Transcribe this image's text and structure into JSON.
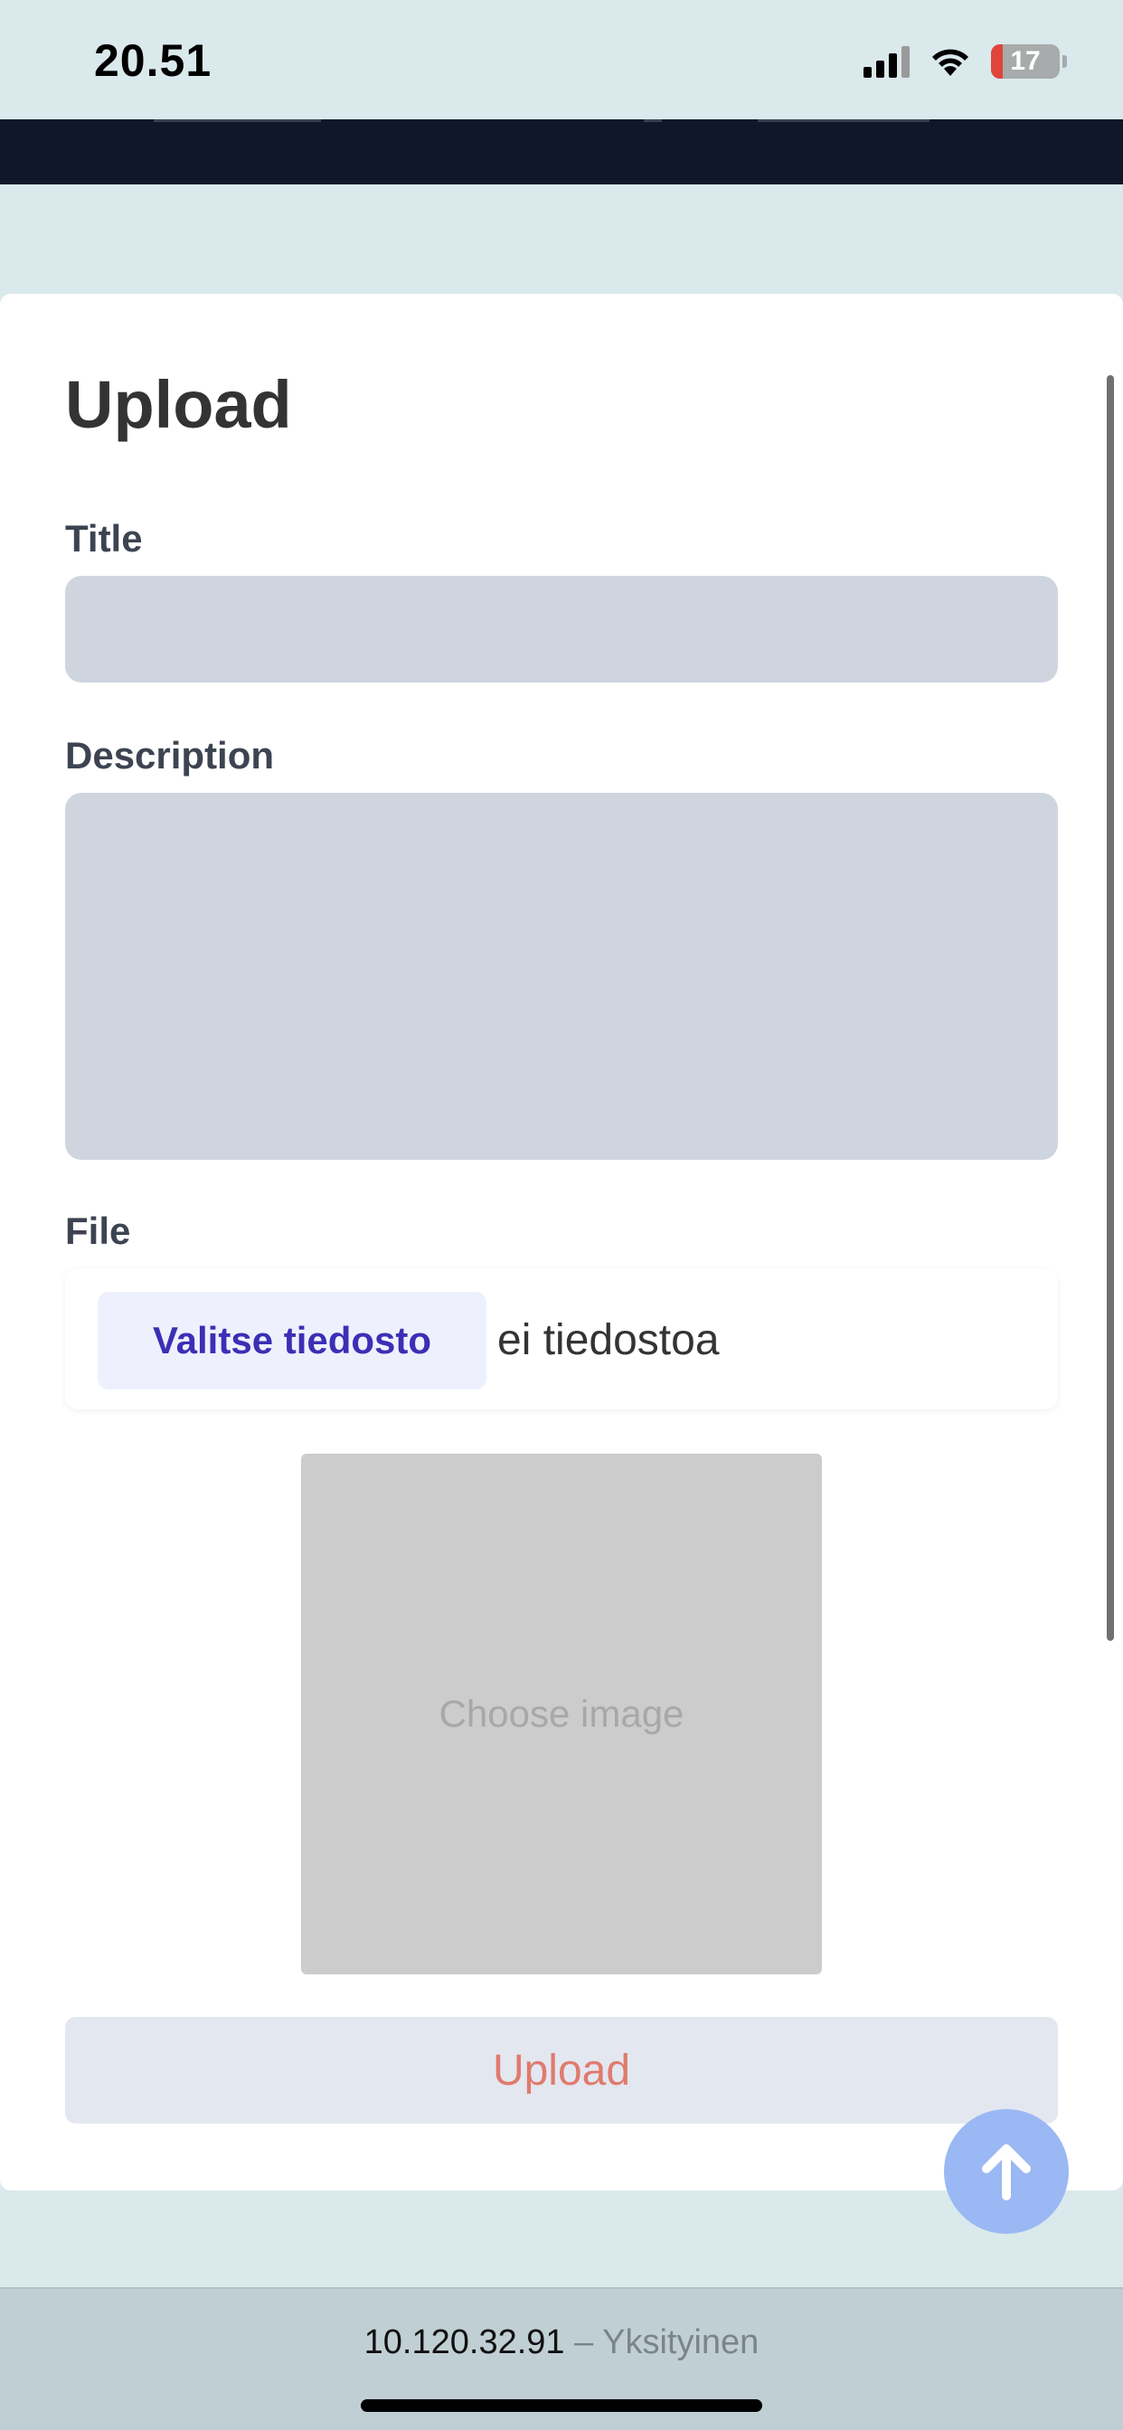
{
  "status_bar": {
    "time": "20.51",
    "battery_level": "17",
    "battery_fraction": 0.17,
    "battery_color": "#e0443a",
    "icons": [
      "signal-icon",
      "wifi-icon",
      "battery-icon"
    ]
  },
  "form": {
    "title": "Upload",
    "title_label": "Title",
    "title_value": "",
    "description_label": "Description",
    "description_value": "",
    "file_label": "File",
    "file_button_label": "Valitse tiedosto",
    "file_status": "ei tiedostoa",
    "image_placeholder": "Choose image",
    "submit_label": "Upload"
  },
  "colors": {
    "page_background": "#dae9eb",
    "nav_background": "#11172a",
    "input_background": "#cfd5df",
    "file_button_text": "#3b2fb5",
    "submit_text": "#e07a6e",
    "fab_background": "#9ab8f3"
  },
  "fab": {
    "icon": "arrow-up-icon"
  },
  "url_bar": {
    "host": "10.120.32.91",
    "separator": "–",
    "mode": "Yksityinen"
  }
}
